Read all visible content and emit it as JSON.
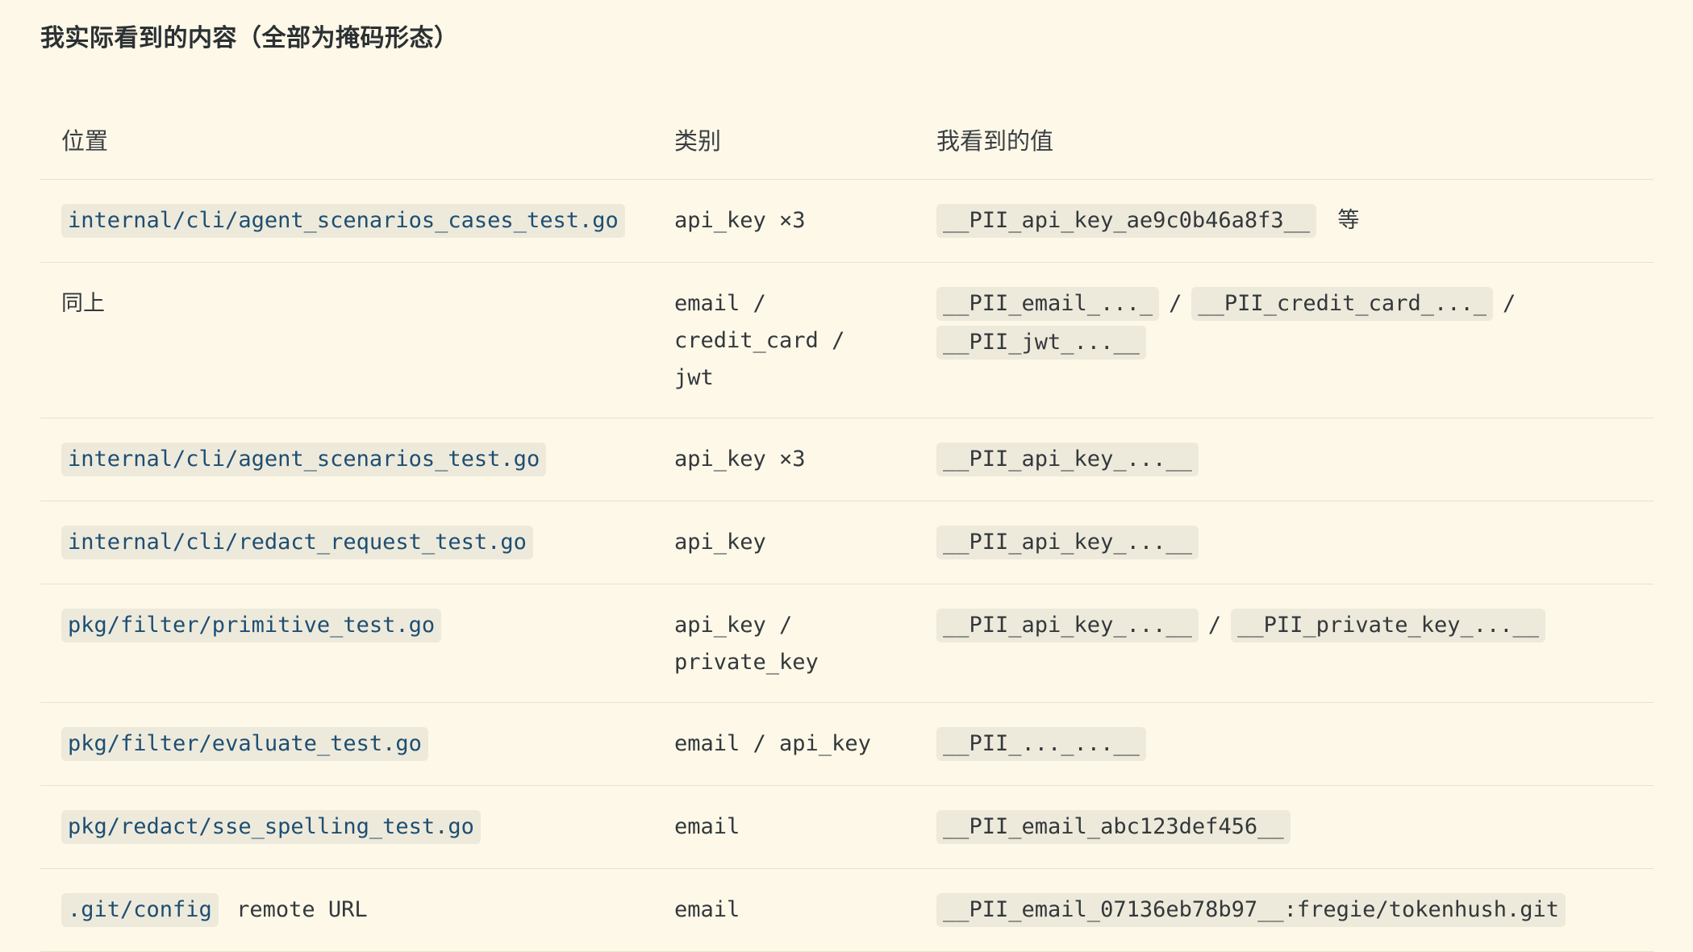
{
  "title": "我实际看到的内容（全部为掩码形态）",
  "columns": [
    "位置",
    "类别",
    "我看到的值"
  ],
  "rows": [
    {
      "location_code": "internal/cli/agent_scenarios_cases_test.go",
      "category_lines": [
        "api_key ×3"
      ],
      "values": [
        "__PII_api_key_ae9c0b46a8f3__"
      ],
      "suffix": "等"
    },
    {
      "location_text": "同上",
      "category_lines": [
        "email /",
        "credit_card / jwt"
      ],
      "values": [
        "__PII_email_..._",
        "__PII_credit_card_..._",
        "__PII_jwt_...__"
      ]
    },
    {
      "location_code": "internal/cli/agent_scenarios_test.go",
      "category_lines": [
        "api_key ×3"
      ],
      "values": [
        "__PII_api_key_...__"
      ]
    },
    {
      "location_code": "internal/cli/redact_request_test.go",
      "category_lines": [
        "api_key"
      ],
      "values": [
        "__PII_api_key_...__"
      ]
    },
    {
      "location_code": "pkg/filter/primitive_test.go",
      "category_lines": [
        "api_key /",
        "private_key"
      ],
      "values": [
        "__PII_api_key_...__",
        "__PII_private_key_...__"
      ]
    },
    {
      "location_code": "pkg/filter/evaluate_test.go",
      "category_lines": [
        "email / api_key"
      ],
      "values": [
        "__PII_..._...__"
      ]
    },
    {
      "location_code": "pkg/redact/sse_spelling_test.go",
      "category_lines": [
        "email"
      ],
      "values": [
        "__PII_email_abc123def456__"
      ]
    },
    {
      "location_code": ".git/config",
      "location_suffix": "remote URL",
      "category_lines": [
        "email"
      ],
      "values": [
        "__PII_email_07136eb78b97__:fregie/tokenhush.git"
      ]
    }
  ],
  "separator": "/"
}
